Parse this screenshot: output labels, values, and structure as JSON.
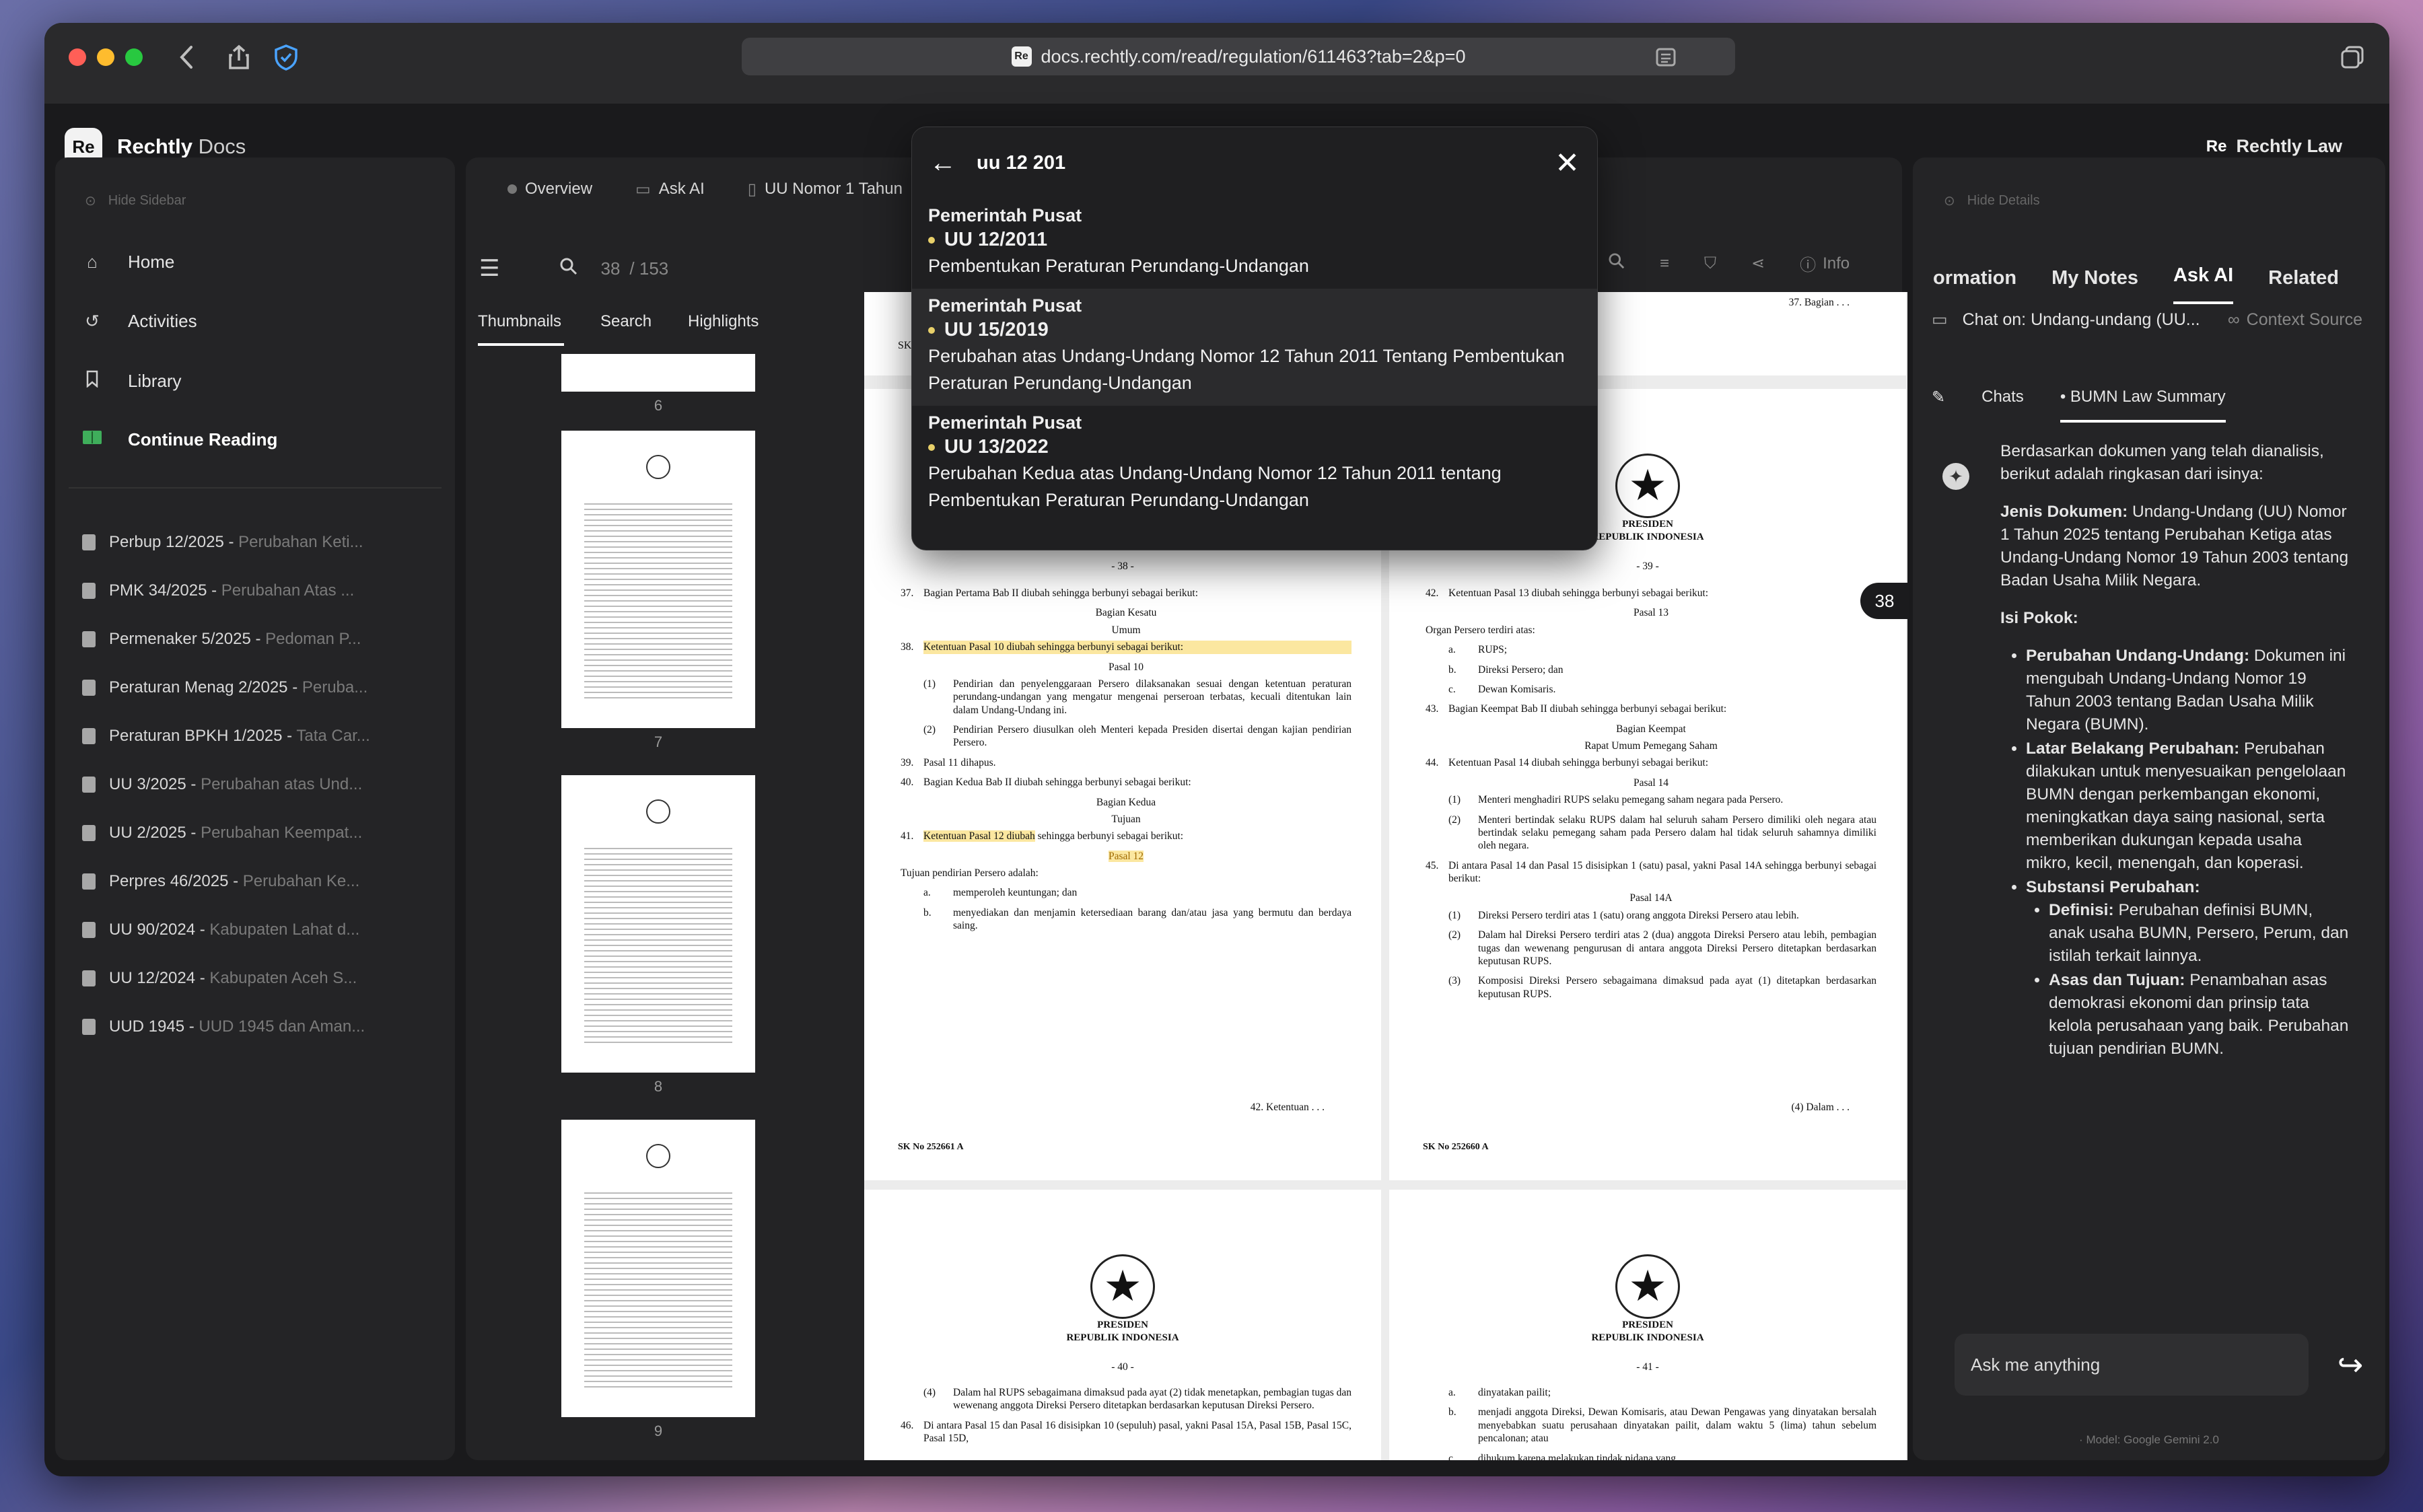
{
  "browser": {
    "url": "docs.rechtly.com/read/regulation/611463?tab=2&p=0"
  },
  "app": {
    "brand_bold": "Rechtly",
    "brand_light": " Docs",
    "logo_text": "Re",
    "right_label": "Rechtly Law",
    "right_logo": "Re"
  },
  "sidebar": {
    "hide_label": "Hide Sidebar",
    "nav": [
      {
        "label": "Home",
        "icon": "home-icon"
      },
      {
        "label": "Activities",
        "icon": "history-icon"
      },
      {
        "label": "Library",
        "icon": "bookmark-icon"
      },
      {
        "label": "Continue Reading",
        "icon": "book-open-icon"
      }
    ],
    "recent": [
      {
        "code": "Perbup 12/2025 - ",
        "desc": "Perubahan Keti..."
      },
      {
        "code": "PMK 34/2025 - ",
        "desc": "Perubahan Atas ..."
      },
      {
        "code": "Permenaker 5/2025 - ",
        "desc": "Pedoman P..."
      },
      {
        "code": "Peraturan Menag 2/2025 - ",
        "desc": "Peruba..."
      },
      {
        "code": "Peraturan BPKH 1/2025 - ",
        "desc": "Tata Car..."
      },
      {
        "code": "UU 3/2025 - ",
        "desc": "Perubahan atas Und..."
      },
      {
        "code": "UU 2/2025 - ",
        "desc": "Perubahan Keempat..."
      },
      {
        "code": "Perpres 46/2025 - ",
        "desc": "Perubahan Ke..."
      },
      {
        "code": "UU 90/2024 - ",
        "desc": "Kabupaten Lahat d..."
      },
      {
        "code": "UU 12/2024 - ",
        "desc": "Kabupaten Aceh S..."
      },
      {
        "code": "UUD 1945 - ",
        "desc": "UUD 1945 dan Aman..."
      }
    ]
  },
  "doc": {
    "tabs": [
      "Overview",
      "Ask AI",
      "UU Nomor 1 Tahun"
    ],
    "page_current": "38",
    "page_total": "/ 153",
    "sub_tabs": [
      "Thumbnails",
      "Search",
      "Highlights"
    ],
    "toolbar_info": "Info",
    "thumb_labels": [
      "6",
      "7",
      "8",
      "9"
    ],
    "page_badge": "38"
  },
  "pages": {
    "top_right_footer": "37. Bagian . . .",
    "top_left_footer": "SK",
    "p38": {
      "num": "- 38 -",
      "items": [
        {
          "n": "37.",
          "text": "Bagian Pertama Bab II diubah sehingga berbunyi sebagai berikut:"
        },
        {
          "center": "Bagian Kesatu"
        },
        {
          "center": "Umum"
        },
        {
          "n": "38.",
          "text": "Ketentuan Pasal 10 diubah sehingga berbunyi sebagai berikut:",
          "hl": true
        },
        {
          "center": "Pasal 10"
        },
        {
          "sub": "(1)",
          "text": "Pendirian dan penyelenggaraan Persero dilaksanakan sesuai dengan ketentuan peraturan perundang-undangan yang mengatur mengenai perseroan terbatas, kecuali ditentukan lain dalam Undang-Undang ini."
        },
        {
          "sub": "(2)",
          "text": "Pendirian Persero diusulkan oleh Menteri kepada Presiden disertai dengan kajian pendirian Persero."
        },
        {
          "n": "39.",
          "text": "Pasal 11 dihapus."
        },
        {
          "n": "40.",
          "text": "Bagian Kedua Bab II diubah sehingga berbunyi sebagai berikut:"
        },
        {
          "center": "Bagian Kedua"
        },
        {
          "center": "Tujuan"
        },
        {
          "n": "41.",
          "text": "Ketentuan Pasal 12 diubah sehingga berbunyi sebagai berikut:",
          "hl_part": "Ketentuan Pasal 12 diubah"
        },
        {
          "center": "Pasal 12",
          "hl": true
        },
        {
          "plain": "Tujuan pendirian Persero adalah:"
        },
        {
          "sub": "a.",
          "text": "memperoleh keuntungan; dan"
        },
        {
          "sub": "b.",
          "text": "menyediakan dan menjamin ketersediaan barang dan/atau jasa yang bermutu dan berdaya saing."
        }
      ],
      "footer": "42. Ketentuan . . .",
      "sk": "SK No 252661 A"
    },
    "p39": {
      "presiden": "PRESIDEN",
      "republik": "REPUBLIK INDONESIA",
      "num": "- 39 -",
      "items": [
        {
          "n": "42.",
          "text": "Ketentuan Pasal 13 diubah sehingga berbunyi sebagai berikut:"
        },
        {
          "center": "Pasal 13"
        },
        {
          "plain": "Organ Persero terdiri atas:"
        },
        {
          "sub": "a.",
          "text": "RUPS;"
        },
        {
          "sub": "b.",
          "text": "Direksi Persero; dan"
        },
        {
          "sub": "c.",
          "text": "Dewan Komisaris."
        },
        {
          "n": "43.",
          "text": "Bagian Keempat Bab II diubah sehingga berbunyi sebagai berikut:"
        },
        {
          "center": "Bagian Keempat"
        },
        {
          "center": "Rapat Umum Pemegang Saham"
        },
        {
          "n": "44.",
          "text": "Ketentuan Pasal 14 diubah sehingga berbunyi sebagai berikut:"
        },
        {
          "center": "Pasal 14"
        },
        {
          "sub": "(1)",
          "text": "Menteri menghadiri RUPS selaku pemegang saham negara pada Persero."
        },
        {
          "sub": "(2)",
          "text": "Menteri bertindak selaku RUPS dalam hal seluruh saham Persero dimiliki oleh negara atau bertindak selaku pemegang saham pada Persero dalam hal tidak seluruh sahamnya dimiliki oleh negara."
        },
        {
          "n": "45.",
          "text": "Di antara Pasal 14 dan Pasal 15 disisipkan 1 (satu) pasal, yakni Pasal 14A sehingga berbunyi sebagai berikut:"
        },
        {
          "center": "Pasal 14A"
        },
        {
          "sub": "(1)",
          "text": "Direksi Persero terdiri atas 1 (satu) orang anggota Direksi Persero atau lebih."
        },
        {
          "sub": "(2)",
          "text": "Dalam hal Direksi Persero terdiri atas 2 (dua) anggota Direksi Persero atau lebih, pembagian tugas dan wewenang pengurusan di antara anggota Direksi Persero ditetapkan berdasarkan keputusan RUPS."
        },
        {
          "sub": "(3)",
          "text": "Komposisi Direksi Persero sebagaimana dimaksud pada ayat (1) ditetapkan berdasarkan keputusan RUPS."
        }
      ],
      "footer": "(4) Dalam . . .",
      "sk": "SK No 252660 A"
    },
    "p40": {
      "presiden": "PRESIDEN",
      "republik": "REPUBLIK INDONESIA",
      "num": "- 40 -",
      "items": [
        {
          "sub": "(4)",
          "text": "Dalam hal RUPS sebagaimana dimaksud pada ayat (2) tidak menetapkan, pembagian tugas dan wewenang anggota Direksi Persero ditetapkan berdasarkan keputusan Direksi Persero."
        },
        {
          "n": "46.",
          "text": "Di antara Pasal 15 dan Pasal 16 disisipkan 10 (sepuluh) pasal, yakni Pasal 15A, Pasal 15B, Pasal 15C, Pasal 15D,"
        }
      ]
    },
    "p41": {
      "presiden": "PRESIDEN",
      "republik": "REPUBLIK INDONESIA",
      "num": "- 41 -",
      "items": [
        {
          "sub": "a.",
          "text": "dinyatakan pailit;"
        },
        {
          "sub": "b.",
          "text": "menjadi anggota Direksi, Dewan Komisaris, atau Dewan Pengawas yang dinyatakan bersalah menyebabkan suatu perusahaan dinyatakan pailit, dalam waktu 5 (lima) tahun sebelum pencalonan; atau"
        },
        {
          "sub": "c.",
          "text": "dihukum karena melakukan tindak pidana yang"
        }
      ]
    }
  },
  "search_popover": {
    "query": "uu 12 201",
    "results": [
      {
        "gov": "Pemerintah Pusat",
        "code": "UU 12/2011",
        "title": "Pembentukan Peraturan Perundang-Undangan"
      },
      {
        "gov": "Pemerintah Pusat",
        "code": "UU 15/2019",
        "title": "Perubahan atas Undang-Undang Nomor 12 Tahun 2011 Tentang Pembentukan Peraturan Perundang-Undangan"
      },
      {
        "gov": "Pemerintah Pusat",
        "code": "UU 13/2022",
        "title": "Perubahan Kedua atas Undang-Undang Nomor 12 Tahun 2011 tentang Pembentukan Peraturan Perundang-Undangan"
      }
    ]
  },
  "details": {
    "hide_label": "Hide Details",
    "tabs": [
      "ormation",
      "My Notes",
      "Ask AI",
      "Related"
    ],
    "chat_on": "Chat on: Undang-undang (UU...",
    "context_source": "Context Source",
    "chat_tabs": [
      "Chats",
      "• BUMN Law Summary"
    ],
    "intro": "Berdasarkan dokumen yang telah dianalisis, berikut adalah ringkasan dari isinya:",
    "jenis_label": "Jenis Dokumen:",
    "jenis_text": " Undang-Undang (UU) Nomor 1 Tahun 2025 tentang Perubahan Ketiga atas Undang-Undang Nomor 19 Tahun 2003 tentang Badan Usaha Milik Negara.",
    "isi_label": "Isi Pokok:",
    "b1_label": "Perubahan Undang-Undang:",
    "b1_text": " Dokumen ini mengubah Undang-Undang Nomor 19 Tahun 2003 tentang Badan Usaha Milik Negara (BUMN).",
    "b2_label": "Latar Belakang Perubahan:",
    "b2_text": " Perubahan dilakukan untuk menyesuaikan pengelolaan BUMN dengan perkembangan ekonomi, meningkatkan daya saing nasional, serta memberikan dukungan kepada usaha mikro, kecil, menengah, dan koperasi.",
    "b3_label": "Substansi Perubahan:",
    "s1_label": "Definisi:",
    "s1_text": " Perubahan definisi BUMN, anak usaha BUMN, Persero, Perum, dan istilah terkait lainnya.",
    "s2_label": "Asas dan Tujuan:",
    "s2_text": " Penambahan asas demokrasi ekonomi dan prinsip tata kelola perusahaan yang baik. Perubahan tujuan pendirian BUMN.",
    "input_placeholder": "Ask me anything",
    "model": "Model: Google Gemini 2.0"
  }
}
